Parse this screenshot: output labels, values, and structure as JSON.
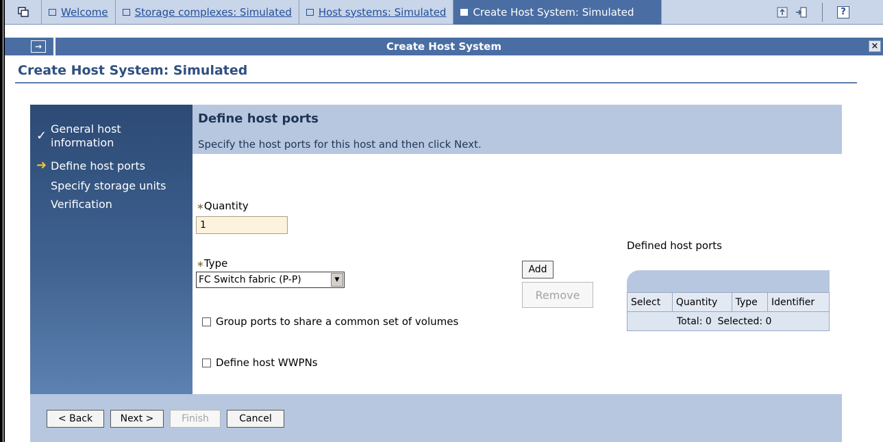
{
  "tabs": {
    "items": [
      {
        "label": "Welcome"
      },
      {
        "label": "Storage complexes: Simulated"
      },
      {
        "label": "Host systems: Simulated"
      },
      {
        "label": "Create Host System: Simulated"
      }
    ]
  },
  "toolbar": {
    "help_label": "?",
    "expand_label": "→",
    "close_label": "×"
  },
  "window_title": "Create Host System",
  "page_title": "Create Host System: Simulated",
  "wizard": {
    "steps": [
      {
        "label_line1": "General host",
        "label_line2": "information",
        "status": "complete",
        "mark": "✓"
      },
      {
        "label_line1": "Define host ports",
        "status": "current",
        "mark": "➜"
      },
      {
        "label_line1": "Specify storage units",
        "status": "pending"
      },
      {
        "label_line1": "Verification",
        "status": "pending"
      }
    ],
    "section_title": "Define host ports",
    "section_instructions": "Specify the host ports for this host and then click Next."
  },
  "form": {
    "required_mark": "∗",
    "quantity_label": "Quantity",
    "quantity_value": "1",
    "type_label": "Type",
    "type_selected": "FC Switch fabric (P-P)",
    "type_arrow": "▼",
    "group_ports_label": "Group ports to share a common set of volumes",
    "group_ports_checked": false,
    "define_wwpn_label": "Define host WWPNs",
    "define_wwpn_checked": false,
    "add_label": "Add",
    "remove_label": "Remove"
  },
  "defined_ports": {
    "label": "Defined host ports",
    "columns": [
      "Select",
      "Quantity",
      "Type",
      "Identifier"
    ],
    "summary": "Total: 0  Selected: 0"
  },
  "footer": {
    "back_label": "< Back",
    "next_label": "Next >",
    "finish_label": "Finish",
    "cancel_label": "Cancel"
  },
  "colors": {
    "accent": "#4a6ea3",
    "nav_bg": "#2c4a74",
    "panel_bg": "#b7c7df",
    "title_text": "#2f4f80",
    "required_field_bg": "#fdf3dc"
  }
}
